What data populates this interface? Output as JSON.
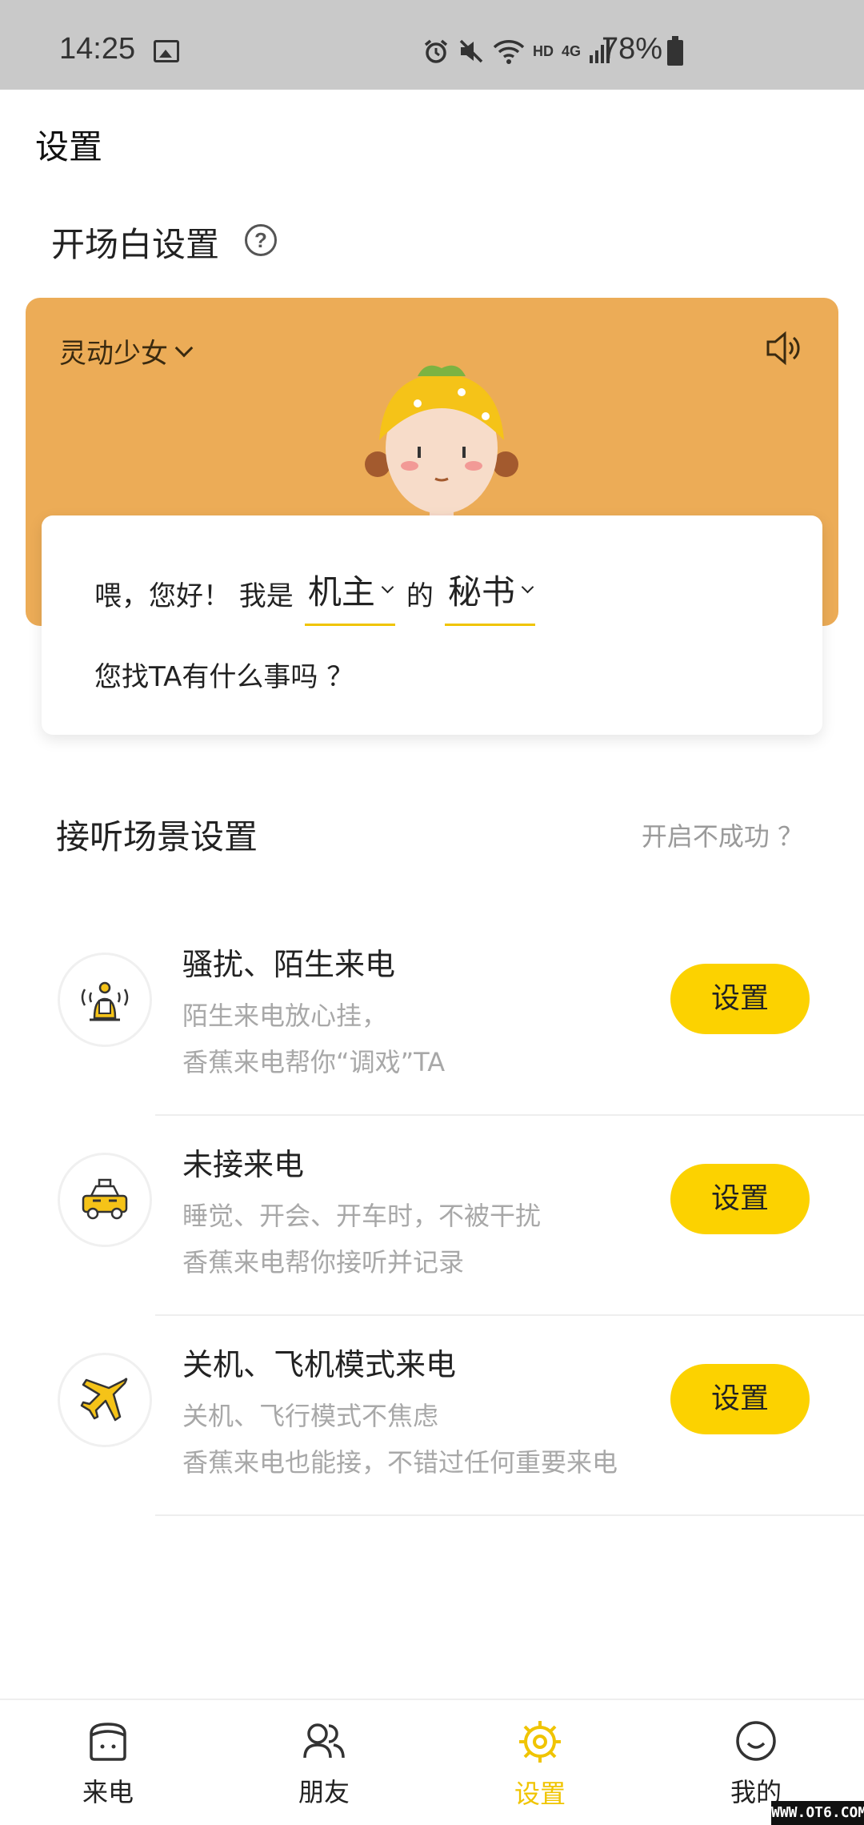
{
  "status_bar": {
    "time": "14:25",
    "battery": "78%",
    "network_label": "HD",
    "network_type": "4G",
    "icons": [
      "image-icon",
      "alarm-icon",
      "mute-icon",
      "wifi-icon",
      "signal-icon",
      "battery-icon"
    ]
  },
  "page": {
    "title": "设置"
  },
  "greeting_section": {
    "title": "开场白设置",
    "help_icon": "question-circle-icon",
    "voice": "灵动少女",
    "line1_prefix": "喂，您好！ 我是",
    "owner": "机主",
    "of": "的",
    "role": "秘书",
    "line2": "您找TA有什么事吗 ？"
  },
  "scenario_section": {
    "title": "接听场景设置",
    "help_link": "开启不成功 ？",
    "rows": [
      {
        "title": "骚扰、陌生来电",
        "desc1": "陌生来电放心挂，",
        "desc2": "香蕉来电帮你“调戏”TA",
        "button": "设置",
        "icon": "harassment-icon"
      },
      {
        "title": "未接来电",
        "desc1": "睡觉、开会、开车时，不被干扰",
        "desc2": "香蕉来电帮你接听并记录",
        "button": "设置",
        "icon": "taxi-icon"
      },
      {
        "title": "关机、飞机模式来电",
        "desc1": "关机、飞行模式不焦虑",
        "desc2": "香蕉来电也能接，不错过任何重要来电",
        "button": "设置",
        "icon": "airplane-icon"
      }
    ]
  },
  "bottom_nav": {
    "items": [
      {
        "label": "来电",
        "icon": "phone-icon"
      },
      {
        "label": "朋友",
        "icon": "friends-icon"
      },
      {
        "label": "设置",
        "icon": "settings-icon",
        "active": true
      },
      {
        "label": "我的",
        "icon": "smile-icon"
      }
    ]
  },
  "watermark": "WWW.OT6.COM",
  "colors": {
    "accent": "#fcd200",
    "hero": "#ecac57",
    "active_nav": "#f0c400"
  }
}
